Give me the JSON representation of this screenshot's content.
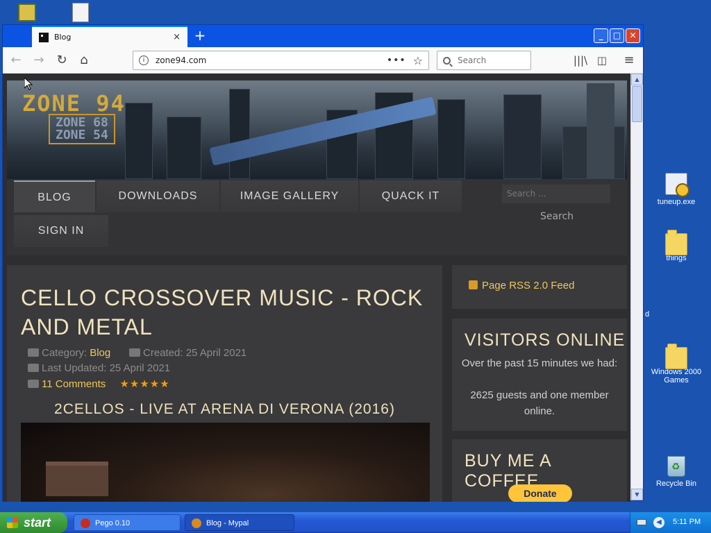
{
  "desktop": {
    "icons": [
      {
        "label": "tuneup.exe",
        "icon": "exe-icon"
      },
      {
        "label": "things",
        "icon": "folder-icon"
      },
      {
        "label": "Windows 2000 Games",
        "icon": "folder-icon"
      },
      {
        "label": "Recycle Bin",
        "icon": "recycle-bin-icon"
      }
    ],
    "partial_char": "d"
  },
  "browser": {
    "tab_title": "Blog",
    "tab_close": "×",
    "new_tab": "+",
    "url": "zone94.com",
    "url_more": "•••",
    "search_placeholder": "Search",
    "window_buttons": {
      "minimize": "_",
      "maximize": "□",
      "close": "✕"
    }
  },
  "site": {
    "logo": "ZONE 94",
    "logo_sub_1": "ZONE 68",
    "logo_sub_2": "ZONE 54",
    "menu": [
      {
        "label": "BLOG",
        "active": true
      },
      {
        "label": "DOWNLOADS",
        "active": false
      },
      {
        "label": "IMAGE GALLERY",
        "active": false
      },
      {
        "label": "QUACK IT",
        "active": false
      },
      {
        "label": "SIGN IN",
        "active": false
      }
    ],
    "search_placeholder": "Search ...",
    "search_button": "Search",
    "article": {
      "title": "CELLO CROSSOVER MUSIC - ROCK AND METAL",
      "category_label": "Category:",
      "category": "Blog",
      "created": "Created: 25 April 2021",
      "last_updated": "Last Updated: 25 April 2021",
      "comments": "11 Comments",
      "rating_stars": "★★★★★",
      "video_title": "2CELLOS - LIVE AT ARENA DI VERONA (2016)"
    },
    "sidebar": {
      "rss": "Page RSS 2.0 Feed",
      "visitors_title": "VISITORS ONLINE",
      "visitors_text_1": "Over the past 15 minutes we had:",
      "visitors_text_2": "2625 guests and one member online.",
      "coffee_title": "BUY ME A COFFEE",
      "donate": "Donate"
    }
  },
  "taskbar": {
    "start": "start",
    "tasks": [
      {
        "label": "Pego 0.10"
      },
      {
        "label": "Blog - Mypal"
      }
    ],
    "clock": "5:11 PM"
  },
  "colors": {
    "desktop": "#1a54b0",
    "accent_gold": "#f0c75a",
    "title_cream": "#f1e3bf",
    "donate_yellow": "#ffc439"
  }
}
